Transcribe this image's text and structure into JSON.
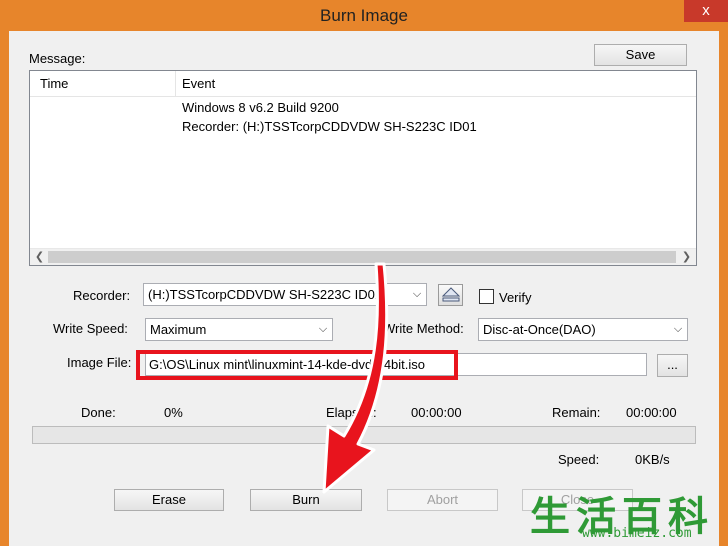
{
  "window": {
    "title": "Burn Image",
    "close_symbol": "x"
  },
  "messages": {
    "label": "Message:",
    "save_label": "Save",
    "columns": [
      "Time",
      "Event"
    ],
    "rows": [
      {
        "time": "",
        "event": "Windows 8 v6.2 Build 9200"
      },
      {
        "time": "",
        "event": "Recorder: (H:)TSSTcorpCDDVDW SH-S223C ID01"
      }
    ]
  },
  "settings": {
    "recorder_label": "Recorder:",
    "recorder_value": "(H:)TSSTcorpCDDVDW SH-S223C ID01",
    "verify_label": "Verify",
    "verify_checked": false,
    "write_speed_label": "Write Speed:",
    "write_speed_value": "Maximum",
    "write_method_label": "Write Method:",
    "write_method_value": "Disc-at-Once(DAO)",
    "image_file_label": "Image File:",
    "image_file_value": "G:\\OS\\Linux mint\\linuxmint-14-kde-dvd-64bit.iso",
    "browse_label": "..."
  },
  "status": {
    "done_label": "Done:",
    "done_value": "0%",
    "elapsed_label": "Elapsed:",
    "elapsed_value": "00:00:00",
    "remain_label": "Remain:",
    "remain_value": "00:00:00",
    "progress_fraction": 0,
    "speed_label": "Speed:",
    "speed_value": "0KB/s"
  },
  "actions": {
    "erase_label": "Erase",
    "burn_label": "Burn",
    "abort_label": "Abort",
    "close_label": "Close"
  },
  "watermark": {
    "chars": "生活百科",
    "url": "www.bimeiz.com"
  },
  "colors": {
    "frame": "#e7852b",
    "highlight": "#e8141d",
    "watermark": "#2f9a36"
  }
}
